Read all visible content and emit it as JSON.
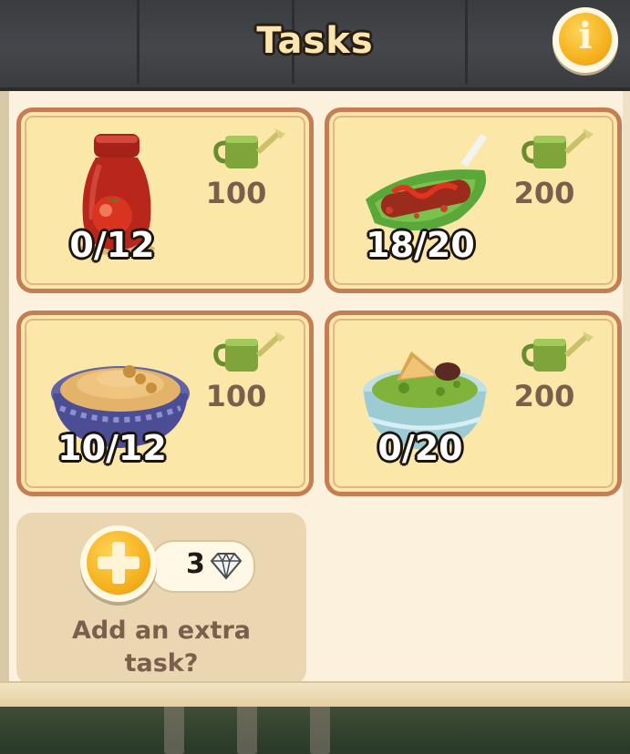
{
  "header": {
    "title": "Tasks",
    "info_glyph": "i",
    "info_icon": "info-icon"
  },
  "tasks": [
    {
      "item": "ketchup bottle",
      "icon": "ketchup-bottle-icon",
      "progress": "0/12",
      "reward_icon": "watering-can-icon",
      "reward": "100"
    },
    {
      "item": "sausage on lettuce",
      "icon": "sausage-dish-icon",
      "progress": "18/20",
      "reward_icon": "watering-can-icon",
      "reward": "200"
    },
    {
      "item": "hummus bowl",
      "icon": "hummus-bowl-icon",
      "progress": "10/12",
      "reward_icon": "watering-can-icon",
      "reward": "100"
    },
    {
      "item": "guacamole bowl",
      "icon": "guacamole-bowl-icon",
      "progress": "0/20",
      "reward_icon": "watering-can-icon",
      "reward": "200"
    }
  ],
  "extra_task": {
    "cost": "3",
    "cost_icon": "diamond-icon",
    "label": "Add an extra task?",
    "button_icon": "plus-icon"
  },
  "colors": {
    "card_fill": "#fbe7a8",
    "card_border": "#c47d55",
    "reward_text": "#7a5f4c",
    "accent_gold": "#f5b21e"
  }
}
